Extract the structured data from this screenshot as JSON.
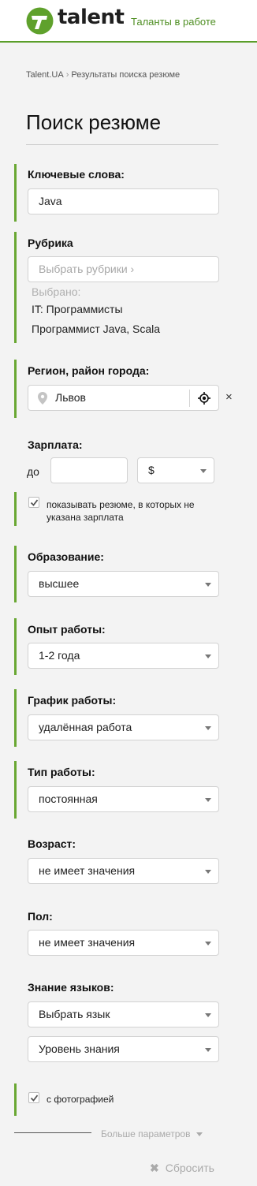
{
  "header": {
    "brand": "talent",
    "tagline": "Таланты в работе"
  },
  "breadcrumb": {
    "home": "Talent.UA",
    "current": "Результаты поиска резюме"
  },
  "page_title": "Поиск резюме",
  "keywords": {
    "label": "Ключевые слова:",
    "value": "Java"
  },
  "rubric": {
    "label": "Рубрика",
    "placeholder": "Выбрать рубрики",
    "selected_label": "Выбрано:",
    "selected": [
      "IT: Программисты",
      "Программист Java, Scala"
    ]
  },
  "region": {
    "label": "Регион, район города:",
    "value": "Львов"
  },
  "salary": {
    "label": "Зарплата:",
    "to_label": "до",
    "amount": "",
    "currency": "$",
    "show_without_salary": "показывать резюме, в которых не указана зарплата",
    "show_without_salary_checked": true
  },
  "education": {
    "label": "Образование:",
    "value": "высшее"
  },
  "experience": {
    "label": "Опыт работы:",
    "value": "1-2 года"
  },
  "schedule": {
    "label": "График работы:",
    "value": "удалённая работа"
  },
  "work_type": {
    "label": "Тип работы:",
    "value": "постоянная"
  },
  "age": {
    "label": "Возраст:",
    "value": "не имеет значения"
  },
  "gender": {
    "label": "Пол:",
    "value": "не имеет значения"
  },
  "languages": {
    "label": "Знание языков:",
    "language": "Выбрать язык",
    "level": "Уровень знания"
  },
  "photo": {
    "label": "с фотографией",
    "checked": true
  },
  "more_params": "Больше параметров",
  "reset": "Сбросить",
  "colors": {
    "accent": "#69a732",
    "brand_green": "#4f8f23"
  }
}
